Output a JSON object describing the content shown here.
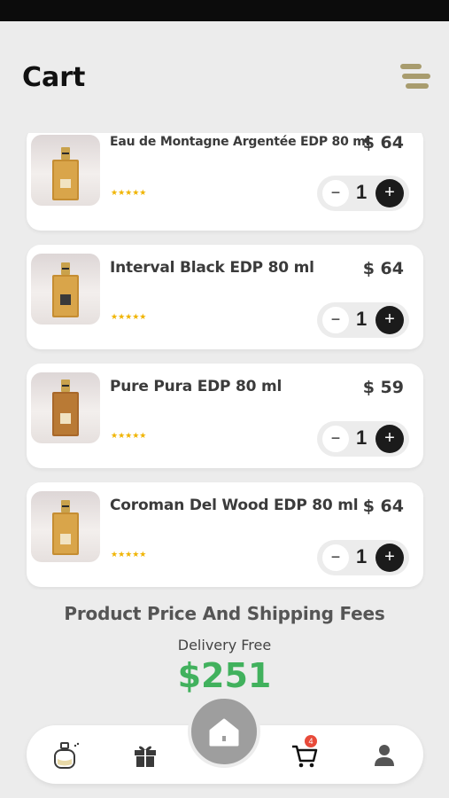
{
  "header": {
    "title": "Cart",
    "menu_icon": "menu-icon"
  },
  "cart": {
    "items": [
      {
        "name": "Eau de Montagne Argentée EDP 80 ml",
        "price": "$ 64",
        "rating_stars": "★★★★★",
        "quantity": "1",
        "minus": "−",
        "plus": "+"
      },
      {
        "name": "Interval Black EDP 80 ml",
        "price": "$ 64",
        "rating_stars": "★★★★★",
        "quantity": "1",
        "minus": "−",
        "plus": "+"
      },
      {
        "name": "Pure Pura EDP 80 ml",
        "price": "$ 59",
        "rating_stars": "★★★★★",
        "quantity": "1",
        "minus": "−",
        "plus": "+"
      },
      {
        "name": "Coroman Del Wood EDP 80 ml",
        "price": "$ 64",
        "rating_stars": "★★★★★",
        "quantity": "1",
        "minus": "−",
        "plus": "+"
      }
    ]
  },
  "summary": {
    "title": "Product Price And Shipping Fees",
    "delivery": "Delivery Free",
    "total": "$251"
  },
  "nav": {
    "cart_badge": "4",
    "items": [
      "perfume-icon",
      "gift-icon",
      "home-icon",
      "cart-icon",
      "user-icon"
    ]
  },
  "colors": {
    "accent_gold": "#a89c6e",
    "total_green": "#41b15d",
    "star_yellow": "#f0b400",
    "badge_red": "#e84a3a"
  }
}
